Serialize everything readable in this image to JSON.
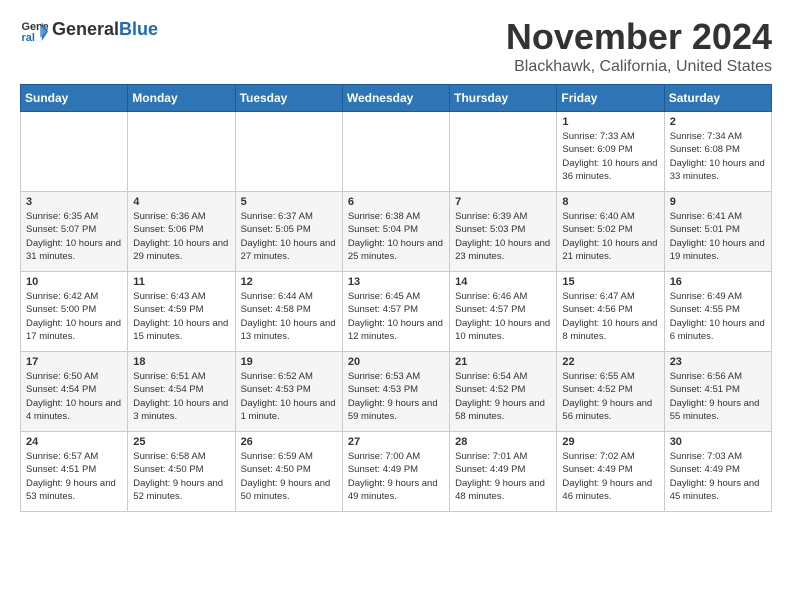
{
  "logo": {
    "text_general": "General",
    "text_blue": "Blue"
  },
  "title": "November 2024",
  "subtitle": "Blackhawk, California, United States",
  "days_of_week": [
    "Sunday",
    "Monday",
    "Tuesday",
    "Wednesday",
    "Thursday",
    "Friday",
    "Saturday"
  ],
  "weeks": [
    [
      {
        "num": "",
        "info": ""
      },
      {
        "num": "",
        "info": ""
      },
      {
        "num": "",
        "info": ""
      },
      {
        "num": "",
        "info": ""
      },
      {
        "num": "",
        "info": ""
      },
      {
        "num": "1",
        "info": "Sunrise: 7:33 AM\nSunset: 6:09 PM\nDaylight: 10 hours\nand 36 minutes."
      },
      {
        "num": "2",
        "info": "Sunrise: 7:34 AM\nSunset: 6:08 PM\nDaylight: 10 hours\nand 33 minutes."
      }
    ],
    [
      {
        "num": "3",
        "info": "Sunrise: 6:35 AM\nSunset: 5:07 PM\nDaylight: 10 hours\nand 31 minutes."
      },
      {
        "num": "4",
        "info": "Sunrise: 6:36 AM\nSunset: 5:06 PM\nDaylight: 10 hours\nand 29 minutes."
      },
      {
        "num": "5",
        "info": "Sunrise: 6:37 AM\nSunset: 5:05 PM\nDaylight: 10 hours\nand 27 minutes."
      },
      {
        "num": "6",
        "info": "Sunrise: 6:38 AM\nSunset: 5:04 PM\nDaylight: 10 hours\nand 25 minutes."
      },
      {
        "num": "7",
        "info": "Sunrise: 6:39 AM\nSunset: 5:03 PM\nDaylight: 10 hours\nand 23 minutes."
      },
      {
        "num": "8",
        "info": "Sunrise: 6:40 AM\nSunset: 5:02 PM\nDaylight: 10 hours\nand 21 minutes."
      },
      {
        "num": "9",
        "info": "Sunrise: 6:41 AM\nSunset: 5:01 PM\nDaylight: 10 hours\nand 19 minutes."
      }
    ],
    [
      {
        "num": "10",
        "info": "Sunrise: 6:42 AM\nSunset: 5:00 PM\nDaylight: 10 hours\nand 17 minutes."
      },
      {
        "num": "11",
        "info": "Sunrise: 6:43 AM\nSunset: 4:59 PM\nDaylight: 10 hours\nand 15 minutes."
      },
      {
        "num": "12",
        "info": "Sunrise: 6:44 AM\nSunset: 4:58 PM\nDaylight: 10 hours\nand 13 minutes."
      },
      {
        "num": "13",
        "info": "Sunrise: 6:45 AM\nSunset: 4:57 PM\nDaylight: 10 hours\nand 12 minutes."
      },
      {
        "num": "14",
        "info": "Sunrise: 6:46 AM\nSunset: 4:57 PM\nDaylight: 10 hours\nand 10 minutes."
      },
      {
        "num": "15",
        "info": "Sunrise: 6:47 AM\nSunset: 4:56 PM\nDaylight: 10 hours\nand 8 minutes."
      },
      {
        "num": "16",
        "info": "Sunrise: 6:49 AM\nSunset: 4:55 PM\nDaylight: 10 hours\nand 6 minutes."
      }
    ],
    [
      {
        "num": "17",
        "info": "Sunrise: 6:50 AM\nSunset: 4:54 PM\nDaylight: 10 hours\nand 4 minutes."
      },
      {
        "num": "18",
        "info": "Sunrise: 6:51 AM\nSunset: 4:54 PM\nDaylight: 10 hours\nand 3 minutes."
      },
      {
        "num": "19",
        "info": "Sunrise: 6:52 AM\nSunset: 4:53 PM\nDaylight: 10 hours\nand 1 minute."
      },
      {
        "num": "20",
        "info": "Sunrise: 6:53 AM\nSunset: 4:53 PM\nDaylight: 9 hours\nand 59 minutes."
      },
      {
        "num": "21",
        "info": "Sunrise: 6:54 AM\nSunset: 4:52 PM\nDaylight: 9 hours\nand 58 minutes."
      },
      {
        "num": "22",
        "info": "Sunrise: 6:55 AM\nSunset: 4:52 PM\nDaylight: 9 hours\nand 56 minutes."
      },
      {
        "num": "23",
        "info": "Sunrise: 6:56 AM\nSunset: 4:51 PM\nDaylight: 9 hours\nand 55 minutes."
      }
    ],
    [
      {
        "num": "24",
        "info": "Sunrise: 6:57 AM\nSunset: 4:51 PM\nDaylight: 9 hours\nand 53 minutes."
      },
      {
        "num": "25",
        "info": "Sunrise: 6:58 AM\nSunset: 4:50 PM\nDaylight: 9 hours\nand 52 minutes."
      },
      {
        "num": "26",
        "info": "Sunrise: 6:59 AM\nSunset: 4:50 PM\nDaylight: 9 hours\nand 50 minutes."
      },
      {
        "num": "27",
        "info": "Sunrise: 7:00 AM\nSunset: 4:49 PM\nDaylight: 9 hours\nand 49 minutes."
      },
      {
        "num": "28",
        "info": "Sunrise: 7:01 AM\nSunset: 4:49 PM\nDaylight: 9 hours\nand 48 minutes."
      },
      {
        "num": "29",
        "info": "Sunrise: 7:02 AM\nSunset: 4:49 PM\nDaylight: 9 hours\nand 46 minutes."
      },
      {
        "num": "30",
        "info": "Sunrise: 7:03 AM\nSunset: 4:49 PM\nDaylight: 9 hours\nand 45 minutes."
      }
    ]
  ]
}
